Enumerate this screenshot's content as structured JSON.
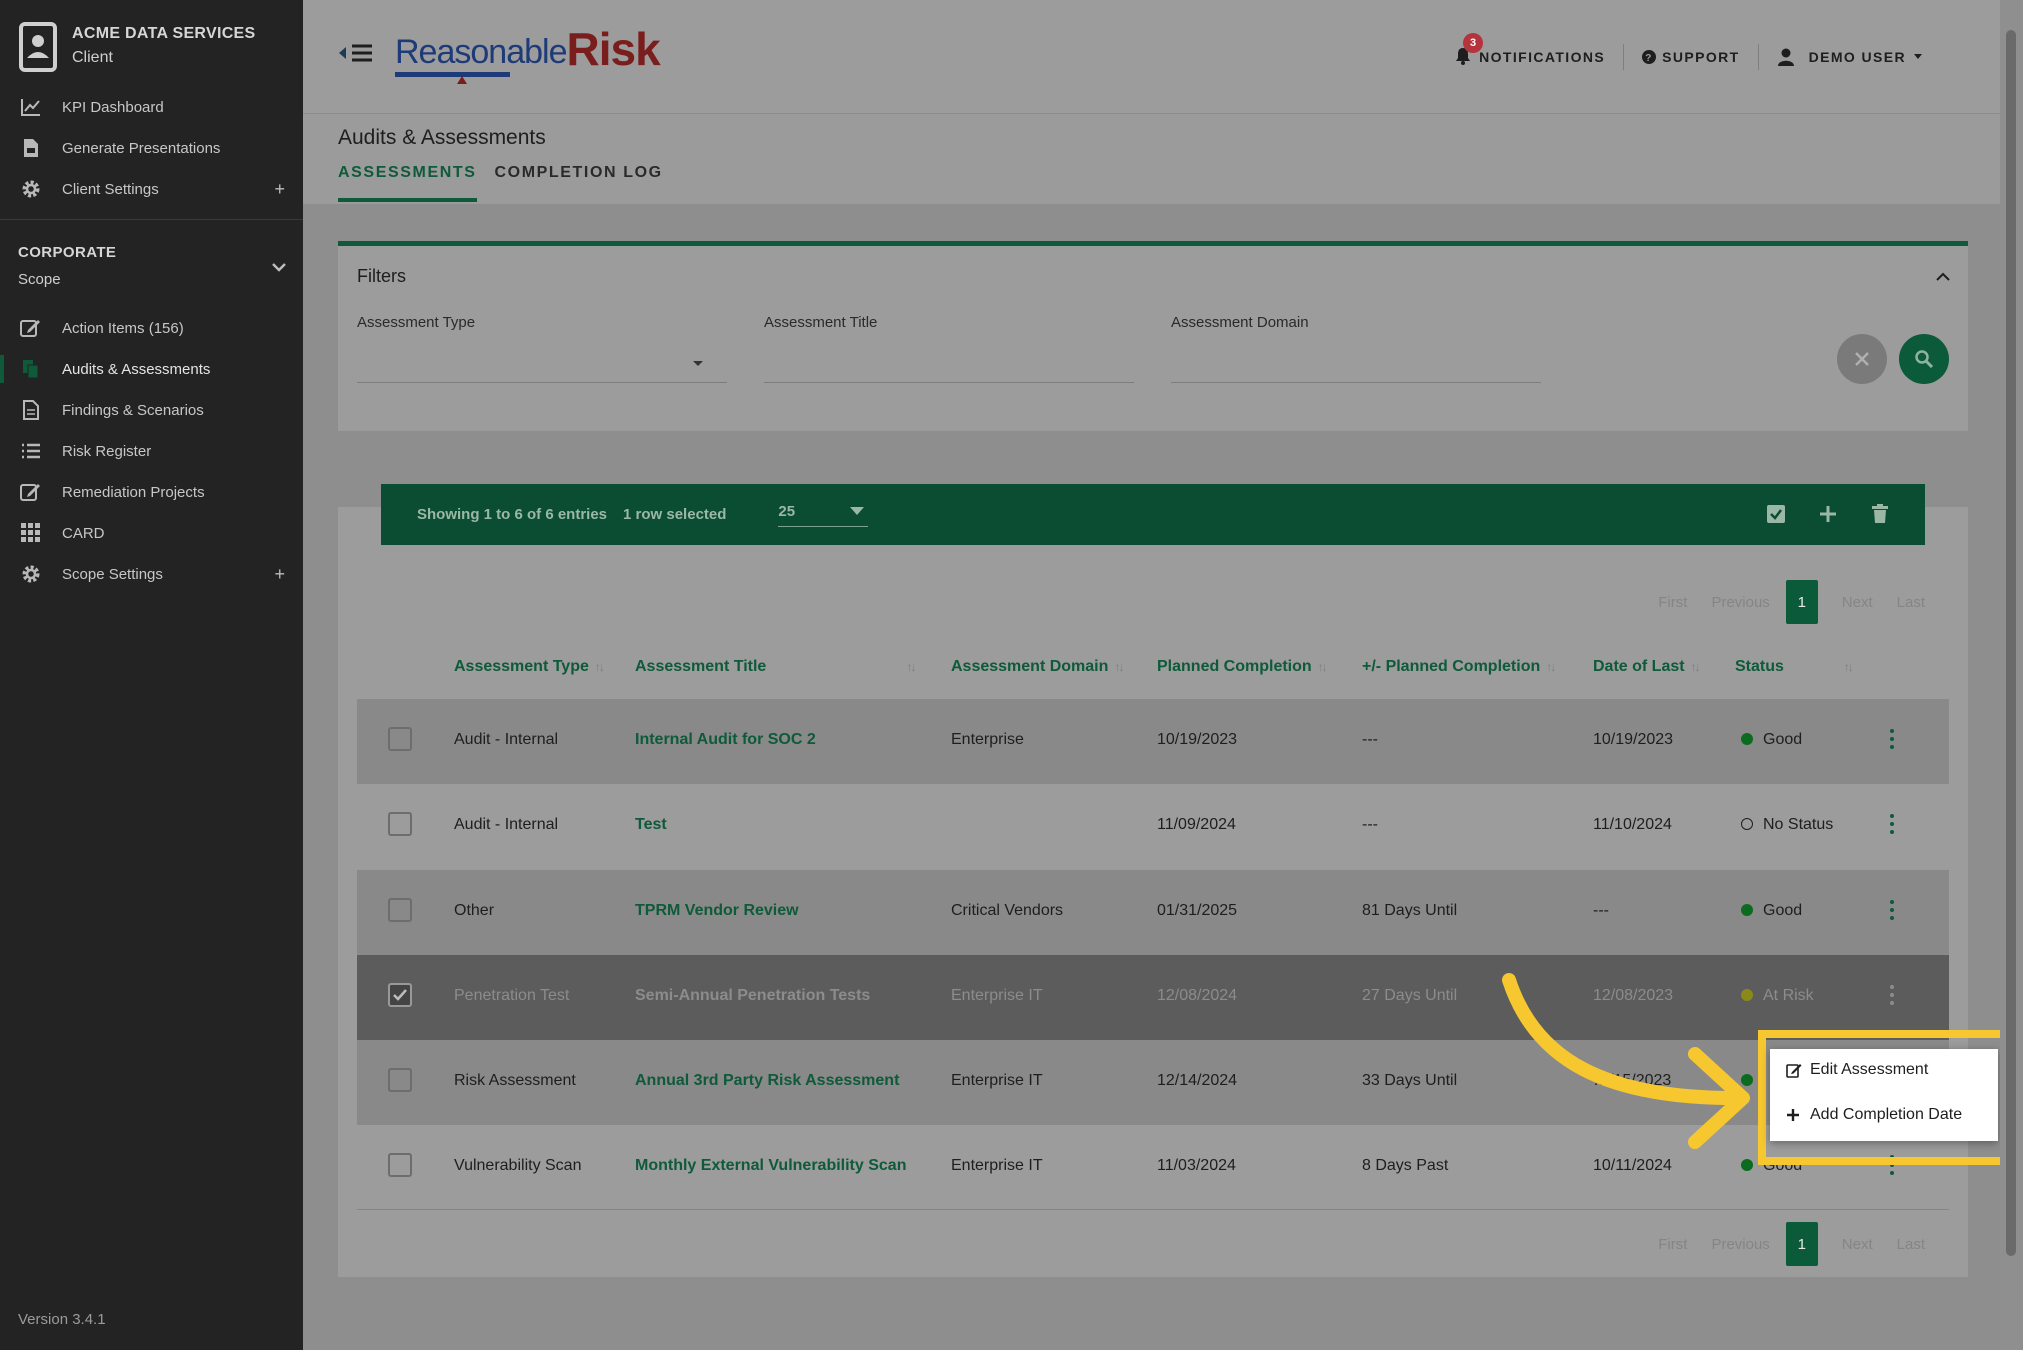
{
  "client": {
    "name": "ACME DATA SERVICES",
    "sub": "Client"
  },
  "nav_top": [
    {
      "label": "KPI Dashboard",
      "icon": "chart-line-icon"
    },
    {
      "label": "Generate Presentations",
      "icon": "presentation-file-icon"
    },
    {
      "label": "Client Settings",
      "icon": "gear-icon",
      "plus": "+"
    }
  ],
  "scope": {
    "title": "CORPORATE",
    "sub": "Scope"
  },
  "nav_scope": [
    {
      "label": "Action Items (156)",
      "icon": "edit-icon"
    },
    {
      "label": "Audits & Assessments",
      "icon": "copy-files-icon"
    },
    {
      "label": "Findings & Scenarios",
      "icon": "document-icon"
    },
    {
      "label": "Risk Register",
      "icon": "list-icon"
    },
    {
      "label": "Remediation Projects",
      "icon": "edit-icon"
    },
    {
      "label": "CARD",
      "icon": "grid-icon"
    },
    {
      "label": "Scope Settings",
      "icon": "gear-icon",
      "plus": "+"
    }
  ],
  "version": "Version 3.4.1",
  "logo": {
    "part1": "Reasonable",
    "part2": "Risk"
  },
  "header": {
    "notifications_label": "NOTIFICATIONS",
    "notifications_count": "3",
    "support_label": "SUPPORT",
    "user_label": "DEMO USER"
  },
  "page": {
    "title": "Audits & Assessments",
    "tabs": [
      "ASSESSMENTS",
      "COMPLETION LOG"
    ]
  },
  "filters": {
    "title": "Filters",
    "fields": [
      "Assessment Type",
      "Assessment Title",
      "Assessment Domain"
    ]
  },
  "toolbar": {
    "info": "Showing 1 to 6 of 6 entries",
    "selected": "1 row selected",
    "page_size": "25"
  },
  "pager": {
    "first": "First",
    "previous": "Previous",
    "current": "1",
    "next": "Next",
    "last": "Last"
  },
  "columns": [
    "Assessment Type",
    "Assessment Title",
    "Assessment Domain",
    "Planned Completion",
    "+/- Planned Completion",
    "Date of Last",
    "Status"
  ],
  "rows": [
    {
      "type": "Audit - Internal",
      "title": "Internal Audit for SOC 2",
      "domain": "Enterprise",
      "planned": "10/19/2023",
      "delta": "---",
      "last": "10/19/2023",
      "status": "Good",
      "status_color": "#0b6b1f",
      "checked": false
    },
    {
      "type": "Audit - Internal",
      "title": "Test",
      "domain": "",
      "planned": "11/09/2024",
      "delta": "---",
      "last": "11/10/2024",
      "status": "No Status",
      "status_color": "none",
      "checked": false
    },
    {
      "type": "Other",
      "title": "TPRM Vendor Review",
      "domain": "Critical Vendors",
      "planned": "01/31/2025",
      "delta": "81 Days Until",
      "last": "---",
      "status": "Good",
      "status_color": "#0b6b1f",
      "checked": false
    },
    {
      "type": "Penetration Test",
      "title": "Semi-Annual Penetration Tests",
      "domain": "Enterprise IT",
      "planned": "12/08/2024",
      "delta": "27 Days Until",
      "last": "12/08/2023",
      "status": "At Risk",
      "status_color": "#8a8a1a",
      "checked": true
    },
    {
      "type": "Risk Assessment",
      "title": "Annual 3rd Party Risk Assessment",
      "domain": "Enterprise IT",
      "planned": "12/14/2024",
      "delta": "33 Days Until",
      "last": "…/15/2023",
      "status": "",
      "status_color": "#0b6b1f",
      "checked": false
    },
    {
      "type": "Vulnerability Scan",
      "title": "Monthly External Vulnerability Scan",
      "domain": "Enterprise IT",
      "planned": "11/03/2024",
      "delta": "8 Days Past",
      "last": "10/11/2024",
      "status": "Good",
      "status_color": "#0b6b1f",
      "checked": false
    }
  ],
  "context_menu": {
    "edit": "Edit Assessment",
    "add": "Add Completion Date"
  },
  "colors": {
    "brand_green": "#0e5a3a",
    "highlight": "#f7c730"
  }
}
